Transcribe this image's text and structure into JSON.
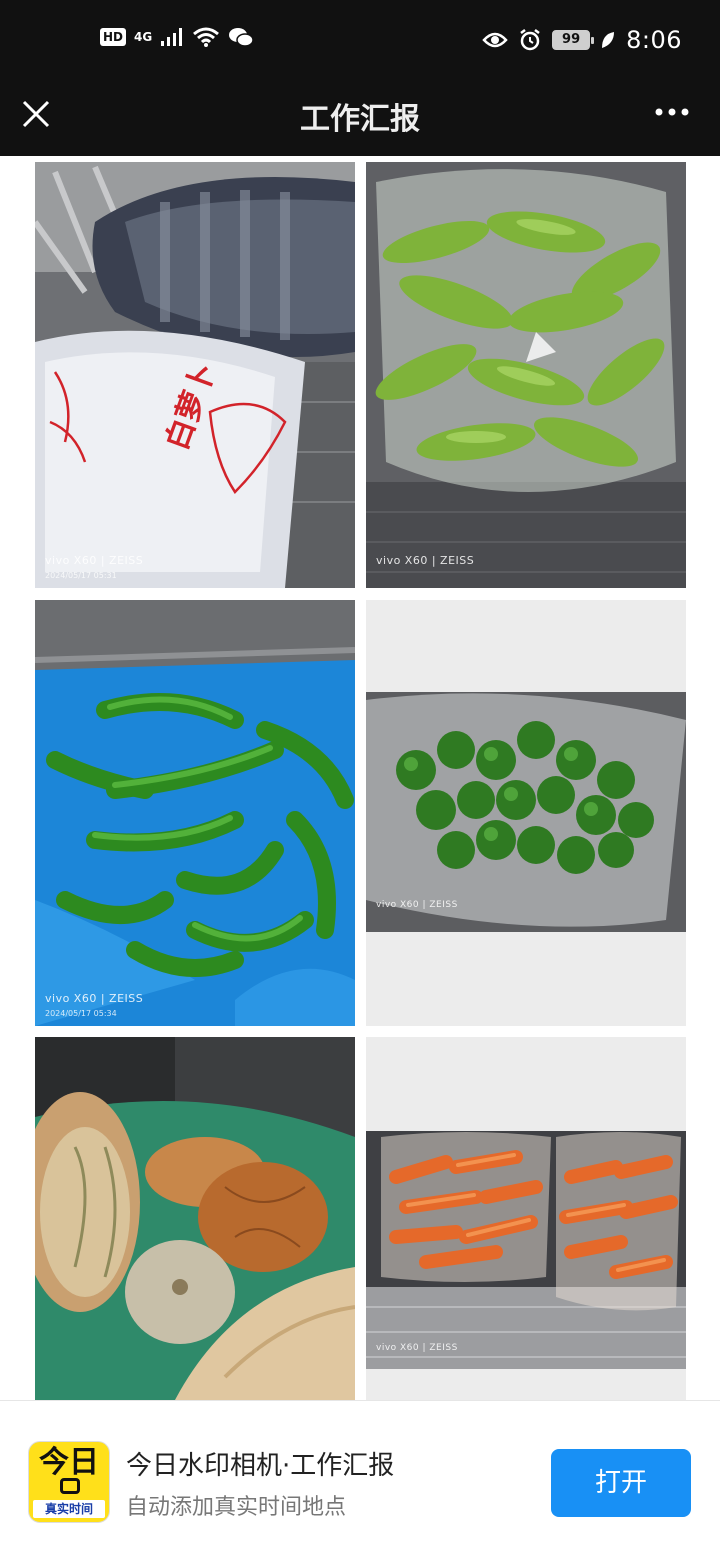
{
  "status_bar": {
    "left_badge": "HD",
    "network": "4G",
    "battery": "99",
    "time": "8:06",
    "icons": [
      "hd-icon",
      "signal-icon",
      "wifi-icon",
      "wechat-icon",
      "eye-icon",
      "alarm-icon",
      "battery-icon",
      "leaf-icon"
    ]
  },
  "nav": {
    "title": "工作汇报",
    "close_icon": "close-icon",
    "more_icon": "more-dots-icon"
  },
  "photos": [
    {
      "subject": "white bags of radish",
      "watermark": "vivo X60 | ZEISS",
      "date": "2024/05/17 05:31"
    },
    {
      "subject": "bag of green squash",
      "watermark": "vivo X60 | ZEISS",
      "date": ""
    },
    {
      "subject": "green chili peppers on blue plastic",
      "watermark": "vivo X60 | ZEISS",
      "date": "2024/05/17 05:34"
    },
    {
      "subject": "bag of green bell peppers",
      "watermark": "vivo X60 | ZEISS",
      "date": ""
    },
    {
      "subject": "pumpkins and squash",
      "watermark": "",
      "date": ""
    },
    {
      "subject": "bags of carrots",
      "watermark": "vivo X60 | ZEISS",
      "date": ""
    }
  ],
  "radish_bag_text": "白萝卜",
  "banner": {
    "icon_big": "今日",
    "icon_sub": "真实时间",
    "app_name": "今日水印相机·工作汇报",
    "app_desc": "自动添加真实时间地点",
    "open_label": "打开"
  },
  "colors": {
    "bar_bg": "#111111",
    "button_blue": "#1890f5",
    "icon_yellow": "#ffe01a"
  }
}
